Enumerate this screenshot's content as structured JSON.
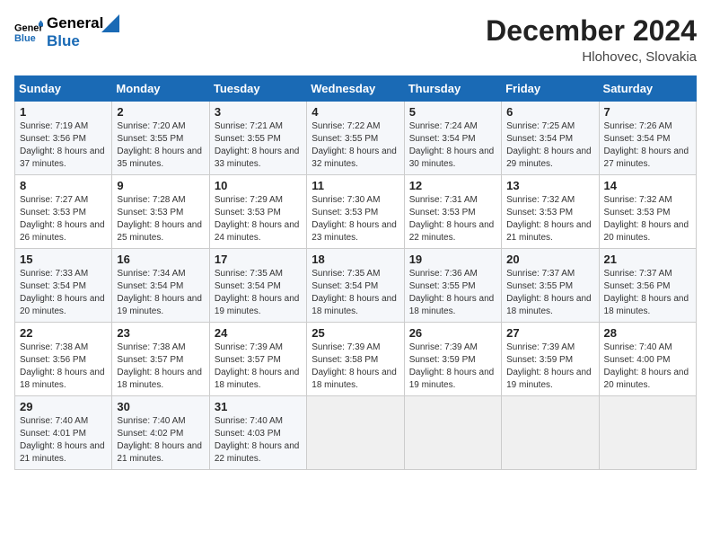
{
  "header": {
    "logo_line1": "General",
    "logo_line2": "Blue",
    "month_year": "December 2024",
    "location": "Hlohovec, Slovakia"
  },
  "days_of_week": [
    "Sunday",
    "Monday",
    "Tuesday",
    "Wednesday",
    "Thursday",
    "Friday",
    "Saturday"
  ],
  "weeks": [
    [
      {
        "day": "1",
        "sunrise": "7:19 AM",
        "sunset": "3:56 PM",
        "daylight": "8 hours and 37 minutes"
      },
      {
        "day": "2",
        "sunrise": "7:20 AM",
        "sunset": "3:55 PM",
        "daylight": "8 hours and 35 minutes"
      },
      {
        "day": "3",
        "sunrise": "7:21 AM",
        "sunset": "3:55 PM",
        "daylight": "8 hours and 33 minutes"
      },
      {
        "day": "4",
        "sunrise": "7:22 AM",
        "sunset": "3:55 PM",
        "daylight": "8 hours and 32 minutes"
      },
      {
        "day": "5",
        "sunrise": "7:24 AM",
        "sunset": "3:54 PM",
        "daylight": "8 hours and 30 minutes"
      },
      {
        "day": "6",
        "sunrise": "7:25 AM",
        "sunset": "3:54 PM",
        "daylight": "8 hours and 29 minutes"
      },
      {
        "day": "7",
        "sunrise": "7:26 AM",
        "sunset": "3:54 PM",
        "daylight": "8 hours and 27 minutes"
      }
    ],
    [
      {
        "day": "8",
        "sunrise": "7:27 AM",
        "sunset": "3:53 PM",
        "daylight": "8 hours and 26 minutes"
      },
      {
        "day": "9",
        "sunrise": "7:28 AM",
        "sunset": "3:53 PM",
        "daylight": "8 hours and 25 minutes"
      },
      {
        "day": "10",
        "sunrise": "7:29 AM",
        "sunset": "3:53 PM",
        "daylight": "8 hours and 24 minutes"
      },
      {
        "day": "11",
        "sunrise": "7:30 AM",
        "sunset": "3:53 PM",
        "daylight": "8 hours and 23 minutes"
      },
      {
        "day": "12",
        "sunrise": "7:31 AM",
        "sunset": "3:53 PM",
        "daylight": "8 hours and 22 minutes"
      },
      {
        "day": "13",
        "sunrise": "7:32 AM",
        "sunset": "3:53 PM",
        "daylight": "8 hours and 21 minutes"
      },
      {
        "day": "14",
        "sunrise": "7:32 AM",
        "sunset": "3:53 PM",
        "daylight": "8 hours and 20 minutes"
      }
    ],
    [
      {
        "day": "15",
        "sunrise": "7:33 AM",
        "sunset": "3:54 PM",
        "daylight": "8 hours and 20 minutes"
      },
      {
        "day": "16",
        "sunrise": "7:34 AM",
        "sunset": "3:54 PM",
        "daylight": "8 hours and 19 minutes"
      },
      {
        "day": "17",
        "sunrise": "7:35 AM",
        "sunset": "3:54 PM",
        "daylight": "8 hours and 19 minutes"
      },
      {
        "day": "18",
        "sunrise": "7:35 AM",
        "sunset": "3:54 PM",
        "daylight": "8 hours and 18 minutes"
      },
      {
        "day": "19",
        "sunrise": "7:36 AM",
        "sunset": "3:55 PM",
        "daylight": "8 hours and 18 minutes"
      },
      {
        "day": "20",
        "sunrise": "7:37 AM",
        "sunset": "3:55 PM",
        "daylight": "8 hours and 18 minutes"
      },
      {
        "day": "21",
        "sunrise": "7:37 AM",
        "sunset": "3:56 PM",
        "daylight": "8 hours and 18 minutes"
      }
    ],
    [
      {
        "day": "22",
        "sunrise": "7:38 AM",
        "sunset": "3:56 PM",
        "daylight": "8 hours and 18 minutes"
      },
      {
        "day": "23",
        "sunrise": "7:38 AM",
        "sunset": "3:57 PM",
        "daylight": "8 hours and 18 minutes"
      },
      {
        "day": "24",
        "sunrise": "7:39 AM",
        "sunset": "3:57 PM",
        "daylight": "8 hours and 18 minutes"
      },
      {
        "day": "25",
        "sunrise": "7:39 AM",
        "sunset": "3:58 PM",
        "daylight": "8 hours and 18 minutes"
      },
      {
        "day": "26",
        "sunrise": "7:39 AM",
        "sunset": "3:59 PM",
        "daylight": "8 hours and 19 minutes"
      },
      {
        "day": "27",
        "sunrise": "7:39 AM",
        "sunset": "3:59 PM",
        "daylight": "8 hours and 19 minutes"
      },
      {
        "day": "28",
        "sunrise": "7:40 AM",
        "sunset": "4:00 PM",
        "daylight": "8 hours and 20 minutes"
      }
    ],
    [
      {
        "day": "29",
        "sunrise": "7:40 AM",
        "sunset": "4:01 PM",
        "daylight": "8 hours and 21 minutes"
      },
      {
        "day": "30",
        "sunrise": "7:40 AM",
        "sunset": "4:02 PM",
        "daylight": "8 hours and 21 minutes"
      },
      {
        "day": "31",
        "sunrise": "7:40 AM",
        "sunset": "4:03 PM",
        "daylight": "8 hours and 22 minutes"
      },
      null,
      null,
      null,
      null
    ]
  ]
}
